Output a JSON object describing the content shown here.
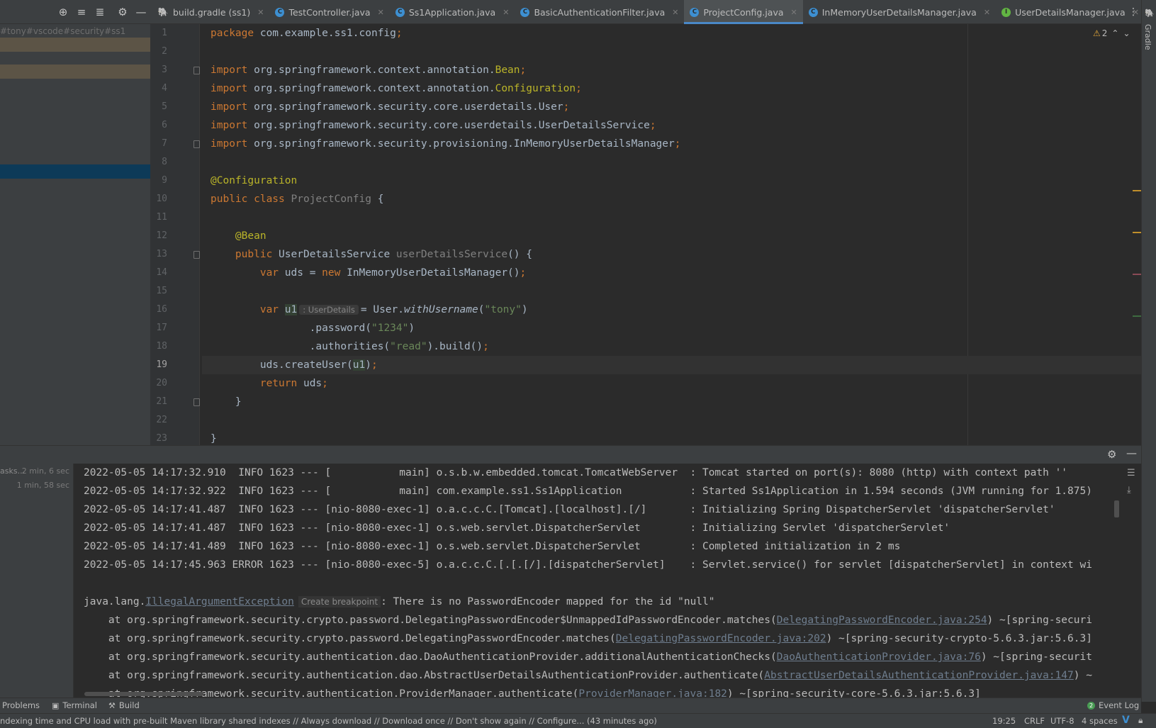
{
  "toolbar": {
    "icons": [
      "locate-icon",
      "expand-all-icon",
      "collapse-all-icon",
      "gear-icon",
      "hide-icon"
    ]
  },
  "tabs": [
    {
      "label": "build.gradle (ss1)",
      "icon": "gradle-icon",
      "active": false
    },
    {
      "label": "TestController.java",
      "icon": "class-icon",
      "active": false
    },
    {
      "label": "Ss1Application.java",
      "icon": "class-icon",
      "active": false
    },
    {
      "label": "BasicAuthenticationFilter.java",
      "icon": "class-icon",
      "active": false
    },
    {
      "label": "ProjectConfig.java",
      "icon": "class-icon",
      "active": true
    },
    {
      "label": "InMemoryUserDetailsManager.java",
      "icon": "class-icon",
      "active": false
    },
    {
      "label": "UserDetailsManager.java",
      "icon": "interface-icon",
      "active": false
    }
  ],
  "project_pane": {
    "path": "#tony#vscode#security#ss1"
  },
  "editor": {
    "warnings_count": "2",
    "current_line": 19,
    "line_numbers": [
      "1",
      "2",
      "3",
      "4",
      "5",
      "6",
      "7",
      "8",
      "9",
      "10",
      "11",
      "12",
      "13",
      "14",
      "15",
      "16",
      "17",
      "18",
      "19",
      "20",
      "21",
      "22",
      "23"
    ],
    "hint_type": ": UserDetails"
  },
  "right_strip": {
    "gradle_label": "Gradle"
  },
  "run_panel": {
    "left_items": [
      {
        "label": "asks...",
        "time": "2 min, 6 sec"
      },
      {
        "label": "",
        "time": "1 min, 58 sec"
      }
    ],
    "log_lines": [
      "2022-05-05 14:17:32.910  INFO 1623 --- [           main] o.s.b.w.embedded.tomcat.TomcatWebServer  : Tomcat started on port(s): 8080 (http) with context path ''",
      "2022-05-05 14:17:32.922  INFO 1623 --- [           main] com.example.ss1.Ss1Application           : Started Ss1Application in 1.594 seconds (JVM running for 1.875)",
      "2022-05-05 14:17:41.487  INFO 1623 --- [nio-8080-exec-1] o.a.c.c.C.[Tomcat].[localhost].[/]       : Initializing Spring DispatcherServlet 'dispatcherServlet'",
      "2022-05-05 14:17:41.487  INFO 1623 --- [nio-8080-exec-1] o.s.web.servlet.DispatcherServlet        : Initializing Servlet 'dispatcherServlet'",
      "2022-05-05 14:17:41.489  INFO 1623 --- [nio-8080-exec-1] o.s.web.servlet.DispatcherServlet        : Completed initialization in 2 ms",
      "2022-05-05 14:17:45.963 ERROR 1623 --- [nio-8080-exec-5] o.a.c.c.C.[.[.[/].[dispatcherServlet]    : Servlet.service() for servlet [dispatcherServlet] in context wi"
    ],
    "exception": {
      "prefix": "java.lang.",
      "class_link": "IllegalArgumentException",
      "breakpoint_label": "Create breakpoint",
      "message": ": There is no PasswordEncoder mapped for the id \"null\""
    },
    "stack": [
      {
        "prefix": "    at org.springframework.security.crypto.password.DelegatingPasswordEncoder$UnmappedIdPasswordEncoder.matches(",
        "link": "DelegatingPasswordEncoder.java:254",
        "suffix": ") ~[spring-securi"
      },
      {
        "prefix": "    at org.springframework.security.crypto.password.DelegatingPasswordEncoder.matches(",
        "link": "DelegatingPasswordEncoder.java:202",
        "suffix": ") ~[spring-security-crypto-5.6.3.jar:5.6.3]"
      },
      {
        "prefix": "    at org.springframework.security.authentication.dao.DaoAuthenticationProvider.additionalAuthenticationChecks(",
        "link": "DaoAuthenticationProvider.java:76",
        "suffix": ") ~[spring-securit"
      },
      {
        "prefix": "    at org.springframework.security.authentication.dao.AbstractUserDetailsAuthenticationProvider.authenticate(",
        "link": "AbstractUserDetailsAuthenticationProvider.java:147",
        "suffix": ") ~"
      },
      {
        "prefix": "    at org.springframework.security.authentication.ProviderManager.authenticate(",
        "link": "ProviderManager.java:182",
        "suffix": ") ~[spring-security-core-5.6.3.jar:5.6.3]"
      }
    ]
  },
  "tool_windows": {
    "problems": "Problems",
    "terminal": "Terminal",
    "build": "Build",
    "event_log": "Event Log",
    "event_count": "2"
  },
  "status_bar": {
    "message": "ndexing time and CPU load with pre-built Maven library shared indexes // Always download // Download once // Don't show again // Configure... (43 minutes ago)",
    "position": "19:25",
    "line_sep": "CRLF",
    "encoding": "UTF-8",
    "indent": "4 spaces"
  },
  "colors": {
    "accent": "#4a88c7",
    "keyword": "#cc7832",
    "annotation": "#bbb529",
    "string": "#6a8759",
    "warning": "#e0a63a"
  }
}
